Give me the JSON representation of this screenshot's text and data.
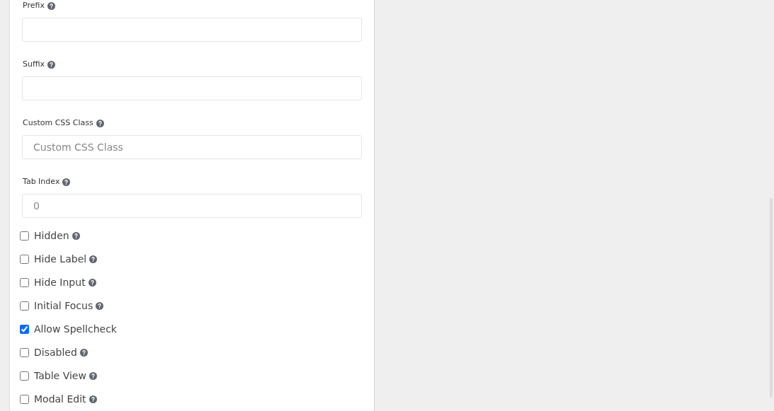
{
  "fields": [
    {
      "label": "Prefix",
      "help": true
    },
    {
      "label": "Suffix",
      "help": true
    },
    {
      "label": "Custom CSS Class",
      "help": true,
      "placeholder": "Custom CSS Class"
    },
    {
      "label": "Tab Index",
      "help": true,
      "placeholder": "0"
    }
  ],
  "options": [
    {
      "label": "Hidden",
      "help": true,
      "checked": false
    },
    {
      "label": "Hide Label",
      "help": true,
      "checked": false
    },
    {
      "label": "Hide Input",
      "help": true,
      "checked": false
    },
    {
      "label": "Initial Focus",
      "help": true,
      "checked": false
    },
    {
      "label": "Allow Spellcheck",
      "help": false,
      "checked": true
    },
    {
      "label": "Disabled",
      "help": true,
      "checked": false
    },
    {
      "label": "Table View",
      "help": true,
      "checked": false
    },
    {
      "label": "Modal Edit",
      "help": true,
      "checked": false
    }
  ]
}
